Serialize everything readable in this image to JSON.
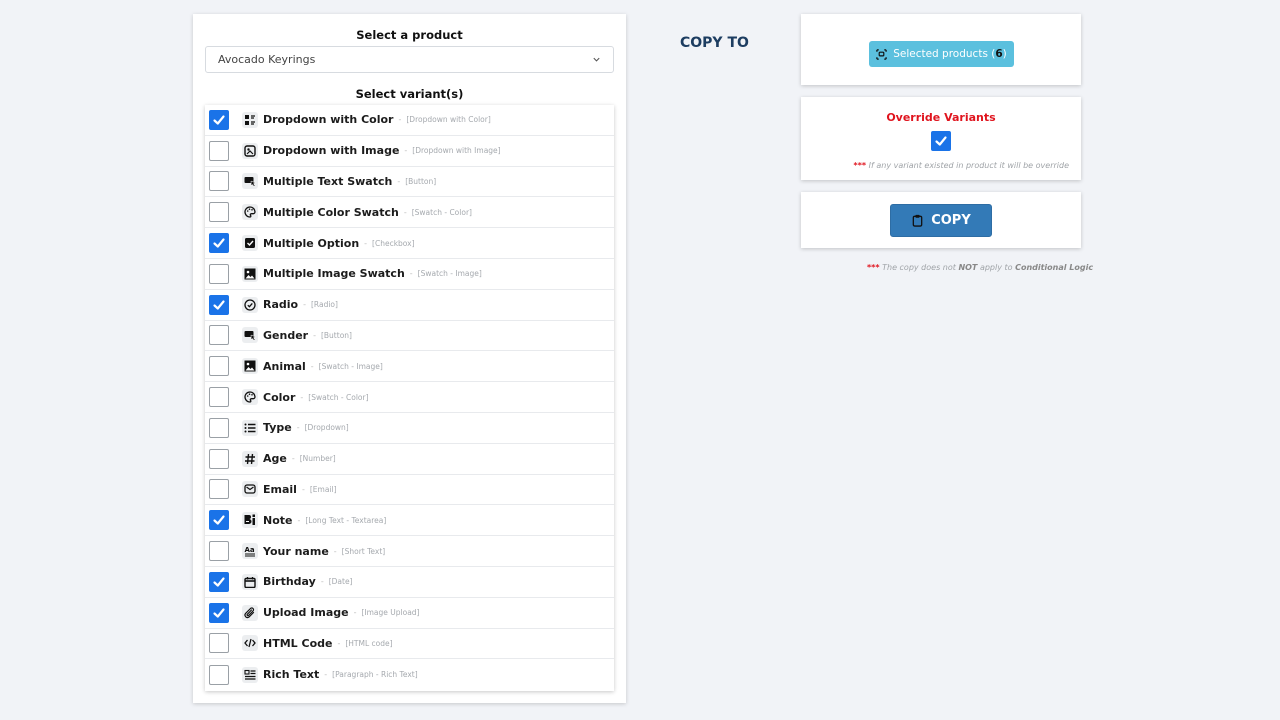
{
  "product_section": {
    "label": "Select a product",
    "selected_product": "Avocado Keyrings"
  },
  "variant_section": {
    "label": "Select variant(s)",
    "separator": "-",
    "variants": [
      {
        "name": "Dropdown with Color",
        "type": "[Dropdown with Color]",
        "icon": "dropdown-color-icon",
        "checked": true
      },
      {
        "name": "Dropdown with Image",
        "type": "[Dropdown with Image]",
        "icon": "dropdown-image-icon",
        "checked": false
      },
      {
        "name": "Multiple Text Swatch",
        "type": "[Button]",
        "icon": "button-cursor-icon",
        "checked": false
      },
      {
        "name": "Multiple Color Swatch",
        "type": "[Swatch - Color]",
        "icon": "palette-icon",
        "checked": false
      },
      {
        "name": "Multiple Option",
        "type": "[Checkbox]",
        "icon": "checkbox-icon",
        "checked": true
      },
      {
        "name": "Multiple Image Swatch",
        "type": "[Swatch - Image]",
        "icon": "image-icon",
        "checked": false
      },
      {
        "name": "Radio",
        "type": "[Radio]",
        "icon": "radio-icon",
        "checked": true
      },
      {
        "name": "Gender",
        "type": "[Button]",
        "icon": "button-cursor-icon",
        "checked": false
      },
      {
        "name": "Animal",
        "type": "[Swatch - Image]",
        "icon": "image-icon",
        "checked": false
      },
      {
        "name": "Color",
        "type": "[Swatch - Color]",
        "icon": "palette-icon",
        "checked": false
      },
      {
        "name": "Type",
        "type": "[Dropdown]",
        "icon": "list-icon",
        "checked": false
      },
      {
        "name": "Age",
        "type": "[Number]",
        "icon": "hash-icon",
        "checked": false
      },
      {
        "name": "Email",
        "type": "[Email]",
        "icon": "email-icon",
        "checked": false
      },
      {
        "name": "Note",
        "type": "[Long Text - Textarea]",
        "icon": "textarea-icon",
        "checked": true
      },
      {
        "name": "Your name",
        "type": "[Short Text]",
        "icon": "short-text-icon",
        "checked": false
      },
      {
        "name": "Birthday",
        "type": "[Date]",
        "icon": "calendar-icon",
        "checked": true
      },
      {
        "name": "Upload Image",
        "type": "[Image Upload]",
        "icon": "paperclip-icon",
        "checked": true
      },
      {
        "name": "HTML Code",
        "type": "[HTML code]",
        "icon": "code-icon",
        "checked": false
      },
      {
        "name": "Rich Text",
        "type": "[Paragraph - Rich Text]",
        "icon": "rich-text-icon",
        "checked": false
      }
    ]
  },
  "copy_to": {
    "heading": "COPY TO",
    "selected_products_label": "Selected products (",
    "selected_products_count": "6",
    "selected_products_close": ")"
  },
  "override": {
    "title": "Override Variants",
    "checked": true,
    "note_stars": "***",
    "note": "If any variant existed in product it will be override"
  },
  "copy": {
    "button_label": "COPY",
    "note_stars": "***",
    "note_part1": "The copy does not",
    "note_bold1": "NOT",
    "note_part2": "apply to",
    "note_bold2": "Conditional Logic"
  },
  "colors": {
    "accent_blue": "#1a73e8",
    "copy_button": "#337ab7",
    "info_button": "#5bc0de",
    "warning_red": "#e0141e",
    "heading_navy": "#1d3d61"
  }
}
